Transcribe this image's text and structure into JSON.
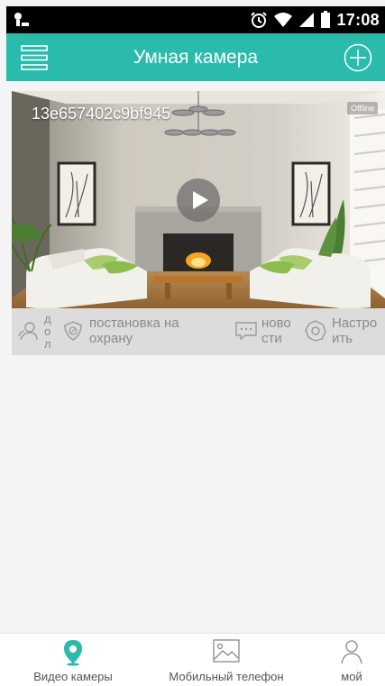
{
  "status_bar": {
    "time": "17:08",
    "icons": [
      "notification-icon",
      "alarm-icon",
      "wifi-icon",
      "signal-icon",
      "battery-icon"
    ]
  },
  "header": {
    "title": "Умная камера",
    "menu_icon": "menu-list-icon",
    "add_icon": "plus-icon",
    "background": "#2bbbad"
  },
  "camera": {
    "id": "13e657402c9bf945",
    "status": "Offline",
    "actions": {
      "playback_lines": [
        "д",
        "о",
        "л"
      ],
      "arm_lines": [
        "постановка на",
        "охрану"
      ],
      "news_lines": [
        "ново",
        "сти"
      ],
      "settings_lines": [
        "Настро",
        "ить"
      ]
    }
  },
  "bottom_nav": {
    "items": [
      {
        "label": "Видео камеры",
        "icon": "location-pin-icon",
        "active": true
      },
      {
        "label": "Мобильный телефон",
        "icon": "image-icon",
        "active": false
      },
      {
        "label": "мой",
        "icon": "user-icon",
        "active": false
      }
    ],
    "active_color": "#2bbbad"
  }
}
